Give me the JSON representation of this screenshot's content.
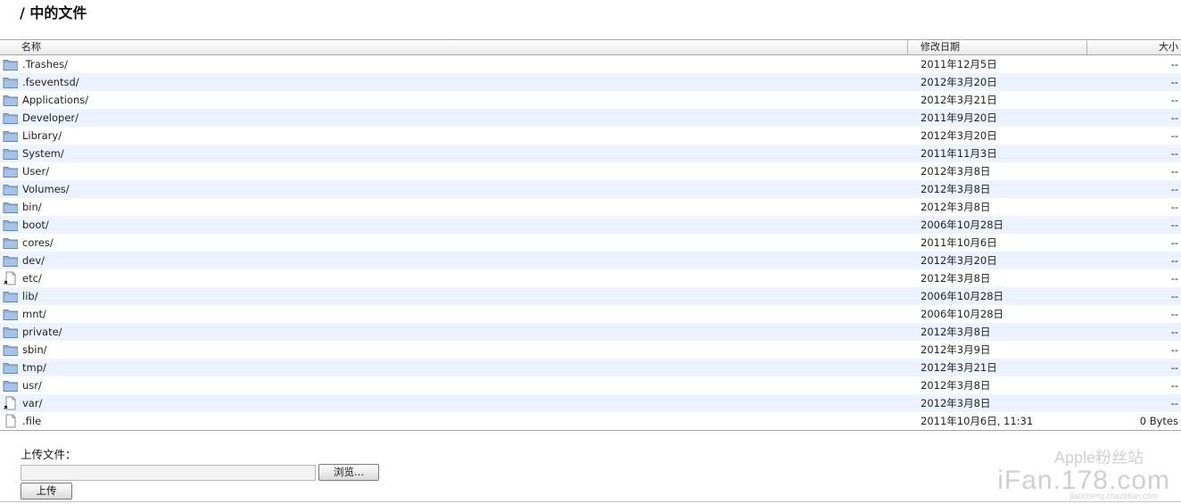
{
  "page": {
    "title": "/ 中的文件"
  },
  "table": {
    "columns": {
      "name": "名称",
      "date": "修改日期",
      "size": "大小"
    },
    "rows": [
      {
        "icon": "folder-icon",
        "name": ".Trashes/",
        "date": "2011年12月5日",
        "size": "--"
      },
      {
        "icon": "folder-icon",
        "name": ".fseventsd/",
        "date": "2012年3月20日",
        "size": "--"
      },
      {
        "icon": "folder-icon",
        "name": "Applications/",
        "date": "2012年3月21日",
        "size": "--"
      },
      {
        "icon": "folder-icon",
        "name": "Developer/",
        "date": "2011年9月20日",
        "size": "--"
      },
      {
        "icon": "folder-icon",
        "name": "Library/",
        "date": "2012年3月20日",
        "size": "--"
      },
      {
        "icon": "folder-icon",
        "name": "System/",
        "date": "2011年11月3日",
        "size": "--"
      },
      {
        "icon": "folder-icon",
        "name": "User/",
        "date": "2012年3月8日",
        "size": "--"
      },
      {
        "icon": "folder-icon",
        "name": "Volumes/",
        "date": "2012年3月8日",
        "size": "--"
      },
      {
        "icon": "folder-icon",
        "name": "bin/",
        "date": "2012年3月8日",
        "size": "--"
      },
      {
        "icon": "folder-icon",
        "name": "boot/",
        "date": "2006年10月28日",
        "size": "--"
      },
      {
        "icon": "folder-icon",
        "name": "cores/",
        "date": "2011年10月6日",
        "size": "--"
      },
      {
        "icon": "folder-icon",
        "name": "dev/",
        "date": "2012年3月20日",
        "size": "--"
      },
      {
        "icon": "alias-icon",
        "name": "etc/",
        "date": "2012年3月8日",
        "size": "--"
      },
      {
        "icon": "folder-icon",
        "name": "lib/",
        "date": "2006年10月28日",
        "size": "--"
      },
      {
        "icon": "folder-icon",
        "name": "mnt/",
        "date": "2006年10月28日",
        "size": "--"
      },
      {
        "icon": "folder-icon",
        "name": "private/",
        "date": "2012年3月8日",
        "size": "--"
      },
      {
        "icon": "folder-icon",
        "name": "sbin/",
        "date": "2012年3月9日",
        "size": "--"
      },
      {
        "icon": "folder-icon",
        "name": "tmp/",
        "date": "2012年3月21日",
        "size": "--"
      },
      {
        "icon": "folder-icon",
        "name": "usr/",
        "date": "2012年3月8日",
        "size": "--"
      },
      {
        "icon": "alias-icon",
        "name": "var/",
        "date": "2012年3月8日",
        "size": "--"
      },
      {
        "icon": "file-icon",
        "name": ".file",
        "date": "2011年10月6日, 11:31",
        "size": "0 Bytes"
      }
    ]
  },
  "upload": {
    "label": "上传文件：",
    "browse_label": "浏览...",
    "submit_label": "上传"
  },
  "watermark": {
    "top": "Apple粉丝站",
    "main": "iFan.178.com",
    "sub": "jiaocheng.chazidian.com"
  },
  "colors": {
    "row_alt": "#edf3fe",
    "folder": "#7fa3cf"
  }
}
